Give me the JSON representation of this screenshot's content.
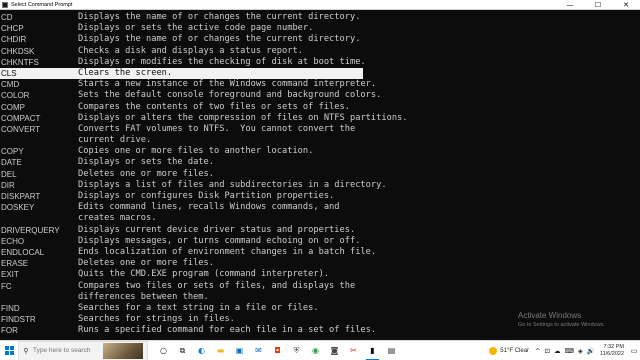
{
  "window": {
    "title": "Select Command Prompt",
    "controls": {
      "minimize": "—",
      "maximize": "☐",
      "close": "✕"
    }
  },
  "commands": [
    {
      "cmd": "CD",
      "desc": "Displays the name of or changes the current directory."
    },
    {
      "cmd": "CHCP",
      "desc": "Displays or sets the active code page number."
    },
    {
      "cmd": "CHDIR",
      "desc": "Displays the name of or changes the current directory."
    },
    {
      "cmd": "CHKDSK",
      "desc": "Checks a disk and displays a status report."
    },
    {
      "cmd": "CHKNTFS",
      "desc": "Displays or modifies the checking of disk at boot time."
    },
    {
      "cmd": "CLS",
      "desc": "Clears the screen.",
      "selected": true
    },
    {
      "cmd": "CMD",
      "desc": "Starts a new instance of the Windows command interpreter."
    },
    {
      "cmd": "COLOR",
      "desc": "Sets the default console foreground and background colors."
    },
    {
      "cmd": "COMP",
      "desc": "Compares the contents of two files or sets of files."
    },
    {
      "cmd": "COMPACT",
      "desc": "Displays or alters the compression of files on NTFS partitions."
    },
    {
      "cmd": "CONVERT",
      "desc": "Converts FAT volumes to NTFS.  You cannot convert the"
    },
    {
      "cmd": "",
      "desc": "current drive."
    },
    {
      "cmd": "COPY",
      "desc": "Copies one or more files to another location."
    },
    {
      "cmd": "DATE",
      "desc": "Displays or sets the date."
    },
    {
      "cmd": "DEL",
      "desc": "Deletes one or more files."
    },
    {
      "cmd": "DIR",
      "desc": "Displays a list of files and subdirectories in a directory."
    },
    {
      "cmd": "DISKPART",
      "desc": "Displays or configures Disk Partition properties."
    },
    {
      "cmd": "DOSKEY",
      "desc": "Edits command lines, recalls Windows commands, and"
    },
    {
      "cmd": "",
      "desc": "creates macros."
    },
    {
      "cmd": "DRIVERQUERY",
      "desc": "Displays current device driver status and properties."
    },
    {
      "cmd": "ECHO",
      "desc": "Displays messages, or turns command echoing on or off."
    },
    {
      "cmd": "ENDLOCAL",
      "desc": "Ends localization of environment changes in a batch file."
    },
    {
      "cmd": "ERASE",
      "desc": "Deletes one or more files."
    },
    {
      "cmd": "EXIT",
      "desc": "Quits the CMD.EXE program (command interpreter)."
    },
    {
      "cmd": "FC",
      "desc": "Compares two files or sets of files, and displays the"
    },
    {
      "cmd": "",
      "desc": "differences between them."
    },
    {
      "cmd": "FIND",
      "desc": "Searches for a text string in a file or files."
    },
    {
      "cmd": "FINDSTR",
      "desc": "Searches for strings in files."
    },
    {
      "cmd": "FOR",
      "desc": "Runs a specified command for each file in a set of files."
    }
  ],
  "watermark": {
    "line1": "Activate Windows",
    "line2": "Go to Settings to activate Windows."
  },
  "taskbar": {
    "search_placeholder": "Type here to search",
    "weather": "51°F  Clear",
    "time": "7:32 PM",
    "date": "11/6/2022",
    "apps": [
      {
        "name": "cortana-icon",
        "glyph": "○",
        "color": "#222222"
      },
      {
        "name": "task-view-icon",
        "glyph": "⧉",
        "color": "#222222"
      },
      {
        "name": "edge-icon",
        "glyph": "◐",
        "color": "#0a7bd6"
      },
      {
        "name": "file-explorer-icon",
        "glyph": "▬",
        "color": "#f0b429"
      },
      {
        "name": "store-icon",
        "glyph": "▣",
        "color": "#0a6cc4"
      },
      {
        "name": "mail-icon",
        "glyph": "✉",
        "color": "#0a6cc4"
      },
      {
        "name": "office-icon",
        "glyph": "◘",
        "color": "#d83b01"
      },
      {
        "name": "security-icon",
        "glyph": "⛨",
        "color": "#555555"
      },
      {
        "name": "chrome-icon",
        "glyph": "◉",
        "color": "#2e9e4a"
      },
      {
        "name": "camera-icon",
        "glyph": "◙",
        "color": "#444444"
      },
      {
        "name": "snipping-icon",
        "glyph": "✂",
        "color": "#c0392b"
      },
      {
        "name": "command-prompt-icon",
        "glyph": "▮",
        "color": "#111111",
        "active": true
      },
      {
        "name": "terminal-icon",
        "glyph": "▤",
        "color": "#333333"
      }
    ],
    "tray": [
      "^",
      "⊡",
      "☁",
      "⌨",
      "◈",
      "🔊"
    ]
  },
  "colors": {
    "console_bg": "#0c0c0c",
    "console_text": "#cccccc",
    "selection_bg": "#f2f2f2",
    "accent": "#0078d7"
  }
}
